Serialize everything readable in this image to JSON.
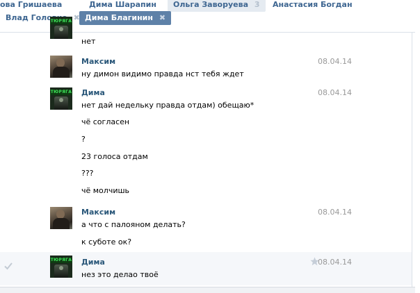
{
  "tabs_top": [
    {
      "label": "ова Гришаева"
    },
    {
      "label": "Дима Шарапин"
    },
    {
      "label": "Ольга Заворуева",
      "count": "3"
    },
    {
      "label": "Анастасия Богдан"
    }
  ],
  "tabs": [
    {
      "label": "Влад Головко",
      "close": "✖"
    },
    {
      "label": "Дима Благинин",
      "close": "✖"
    }
  ],
  "messages": [
    {
      "author": "",
      "date": "",
      "lines": [
        "нет"
      ]
    },
    {
      "author": "Максим",
      "date": "08.04.14",
      "lines": [
        "ну димон видимо правда нст тебя ждет"
      ]
    },
    {
      "author": "Дима",
      "date": "08.04.14",
      "lines": [
        "нет дай недельку правда отдам) обещаю*",
        "чё согласен",
        "?",
        "23 голоса отдам",
        "???",
        "чё молчишь"
      ]
    },
    {
      "author": "Максим",
      "date": "08.04.14",
      "lines": [
        "а что с палояном делать?",
        "к суботе ок?"
      ]
    },
    {
      "author": "Дима",
      "date": "08.04.14",
      "lines": [
        "нез это делао твоё"
      ]
    }
  ],
  "avatars": {
    "dima_sign": "ТЮРЯГА"
  },
  "icons": {
    "check": "check-icon",
    "star": "star-icon"
  },
  "colors": {
    "active_tab": "#5e81a8",
    "author": "#2b587a",
    "date": "#999999"
  }
}
